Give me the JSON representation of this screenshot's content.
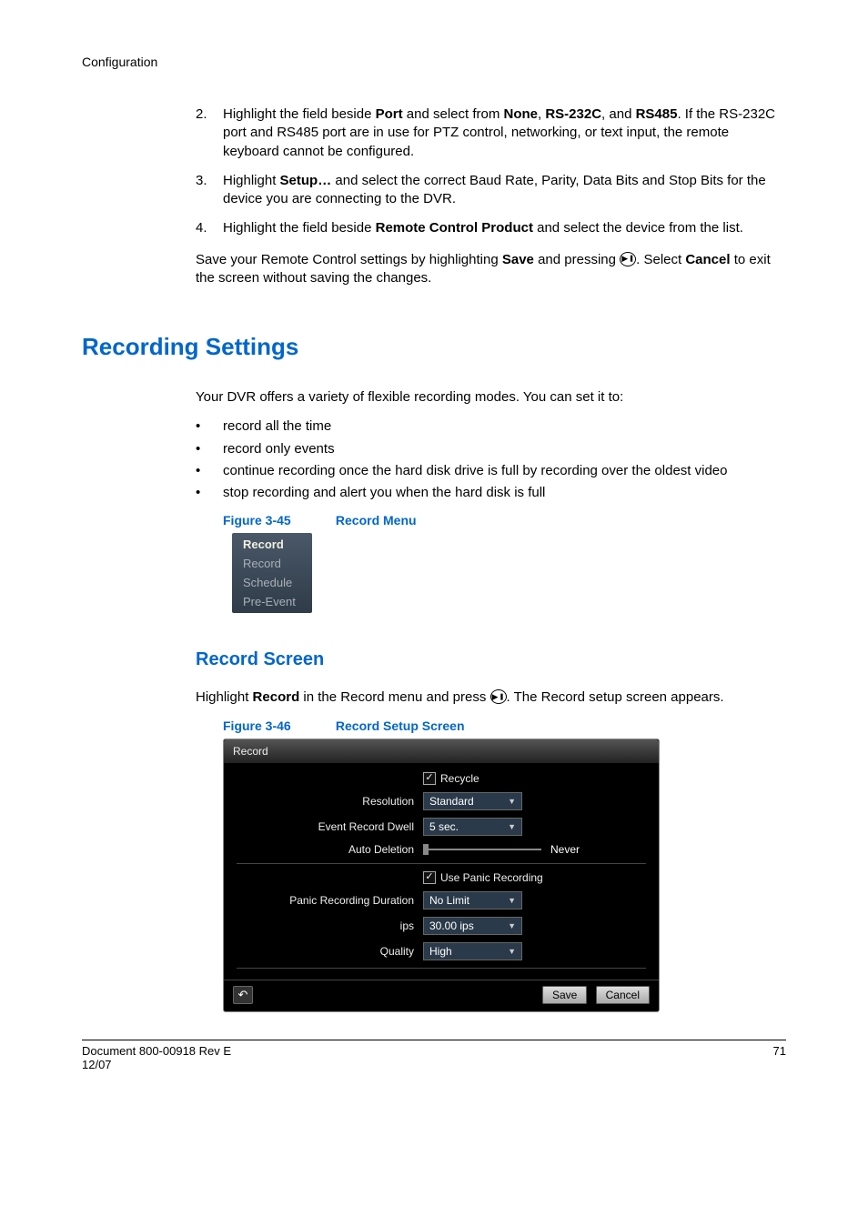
{
  "header": {
    "section": "Configuration"
  },
  "list2": {
    "num": "2.",
    "text_pre": "Highlight the field beside ",
    "b1": "Port",
    "t2": " and select from ",
    "b2": "None",
    "t3": ", ",
    "b3": "RS-232C",
    "t4": ", and ",
    "b4": "RS485",
    "t5": ". If the RS-232C port and RS485 port are in use for PTZ control, networking, or text input, the remote keyboard cannot be configured."
  },
  "list3": {
    "num": "3.",
    "t1": "Highlight ",
    "b1": "Setup…",
    "t2": " and select the correct Baud Rate, Parity, Data Bits and Stop Bits for the device you are connecting to the DVR."
  },
  "list4": {
    "num": "4.",
    "t1": "Highlight the field beside ",
    "b1": "Remote Control Product",
    "t2": " and select the device from the list."
  },
  "save_para": {
    "t1": "Save your Remote Control settings by highlighting ",
    "b1": "Save",
    "t2": " and pressing ",
    "t3": ". Select ",
    "b2": "Cancel",
    "t4": " to exit the screen without saving the changes."
  },
  "h1": "Recording Settings",
  "intro": "Your DVR offers a variety of flexible recording modes. You can set it to:",
  "bullets": [
    "record all the time",
    "record only events",
    "continue recording once the hard disk drive is full by recording over the oldest video",
    "stop recording and alert you when the hard disk is full"
  ],
  "fig45": {
    "num": "Figure 3-45",
    "title": "Record Menu"
  },
  "menu": {
    "title": "Record",
    "items": [
      "Record",
      "Schedule",
      "Pre-Event"
    ]
  },
  "h2": "Record Screen",
  "record_para": {
    "t1": "Highlight ",
    "b1": "Record",
    "t2": " in the Record menu and press ",
    "t3": ". The Record setup screen appears."
  },
  "fig46": {
    "num": "Figure 3-46",
    "title": "Record Setup Screen"
  },
  "setup": {
    "title": "Record",
    "recycle": "Recycle",
    "resolution_label": "Resolution",
    "resolution_value": "Standard",
    "dwell_label": "Event Record Dwell",
    "dwell_value": "5 sec.",
    "auto_del_label": "Auto Deletion",
    "auto_del_value": "Never",
    "use_panic": "Use Panic Recording",
    "panic_dur_label": "Panic Recording Duration",
    "panic_dur_value": "No Limit",
    "ips_label": "ips",
    "ips_value": "30.00 ips",
    "quality_label": "Quality",
    "quality_value": "High",
    "save": "Save",
    "cancel": "Cancel"
  },
  "footer": {
    "doc": "Document 800-00918 Rev E",
    "date": "12/07",
    "page": "71"
  }
}
